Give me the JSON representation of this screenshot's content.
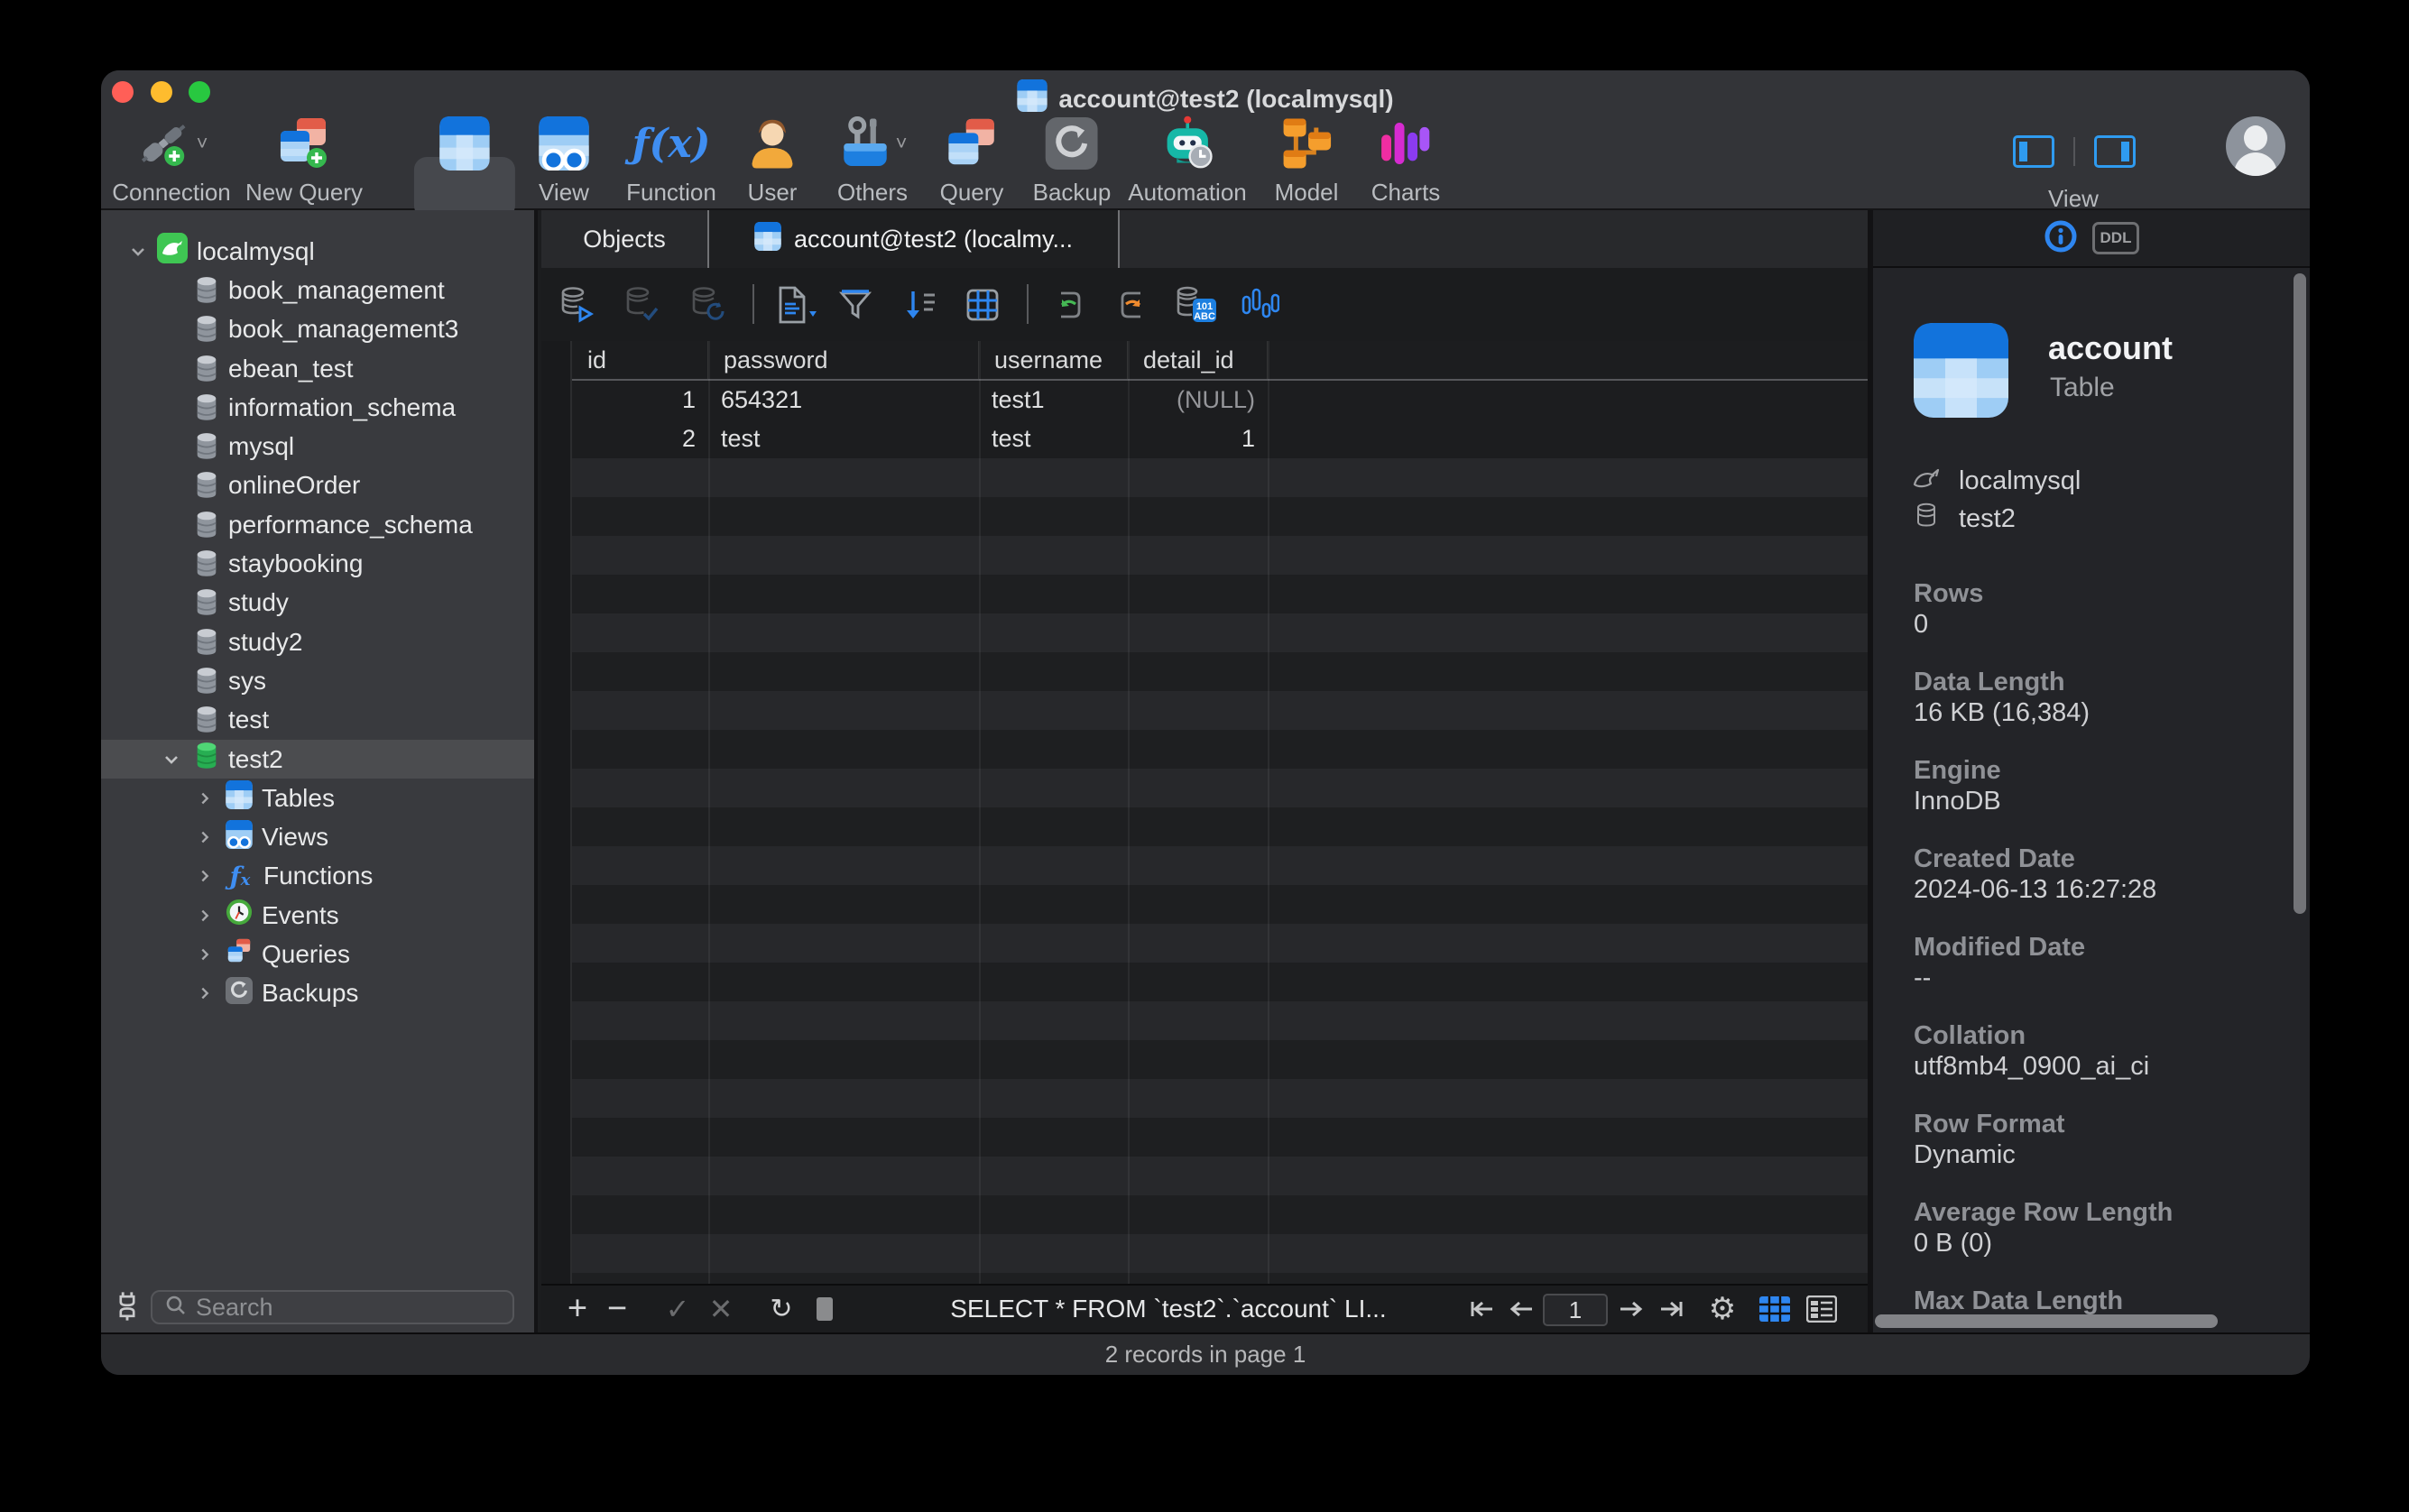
{
  "window": {
    "title": "account@test2 (localmysql)"
  },
  "toolbar": {
    "items": [
      "Connection",
      "New Query",
      "Table",
      "View",
      "Function",
      "User",
      "Others",
      "Query",
      "Backup",
      "Automation",
      "Model",
      "Charts"
    ],
    "view_group_label": "View",
    "fx_glyph": "ƒ(x)",
    "badge_101": "101",
    "badge_abc": "ABC"
  },
  "tabs": {
    "objects_label": "Objects",
    "active_label": "account@test2 (localmy..."
  },
  "sidebar": {
    "connection_label": "localmysql",
    "databases": [
      "book_management",
      "book_management3",
      "ebean_test",
      "information_schema",
      "mysql",
      "onlineOrder",
      "performance_schema",
      "staybooking",
      "study",
      "study2",
      "sys",
      "test"
    ],
    "selected_database": "test2",
    "children": [
      "Tables",
      "Views",
      "Functions",
      "Events",
      "Queries",
      "Backups"
    ],
    "search_placeholder": "Search"
  },
  "grid": {
    "columns": [
      "id",
      "password",
      "username",
      "detail_id"
    ],
    "rows": [
      [
        "1",
        "654321",
        "test1",
        "(NULL)"
      ],
      [
        "2",
        "test",
        "test",
        "1"
      ]
    ]
  },
  "bottom": {
    "sql_preview": "SELECT * FROM `test2`.`account` LI...",
    "page_value": "1"
  },
  "status": {
    "text": "2 records in page 1"
  },
  "panel": {
    "ddl_label": "DDL",
    "object_name": "account",
    "object_type": "Table",
    "connection": "localmysql",
    "database": "test2",
    "fields": [
      {
        "label": "Rows",
        "value": "0"
      },
      {
        "label": "Data Length",
        "value": "16 KB (16,384)"
      },
      {
        "label": "Engine",
        "value": "InnoDB"
      },
      {
        "label": "Created Date",
        "value": "2024-06-13 16:27:28"
      },
      {
        "label": "Modified Date",
        "value": "--"
      },
      {
        "label": "Collation",
        "value": "utf8mb4_0900_ai_ci"
      },
      {
        "label": "Row Format",
        "value": "Dynamic"
      },
      {
        "label": "Average Row Length",
        "value": "0 B (0)"
      },
      {
        "label": "Max Data Length",
        "value": ""
      }
    ]
  },
  "colors": {
    "accent_blue": "#2e86f0",
    "mysql_green": "#34b457",
    "selected_label": "#4e9cf4",
    "traffic": [
      "#ff5f57",
      "#febc2e",
      "#28c840"
    ]
  }
}
